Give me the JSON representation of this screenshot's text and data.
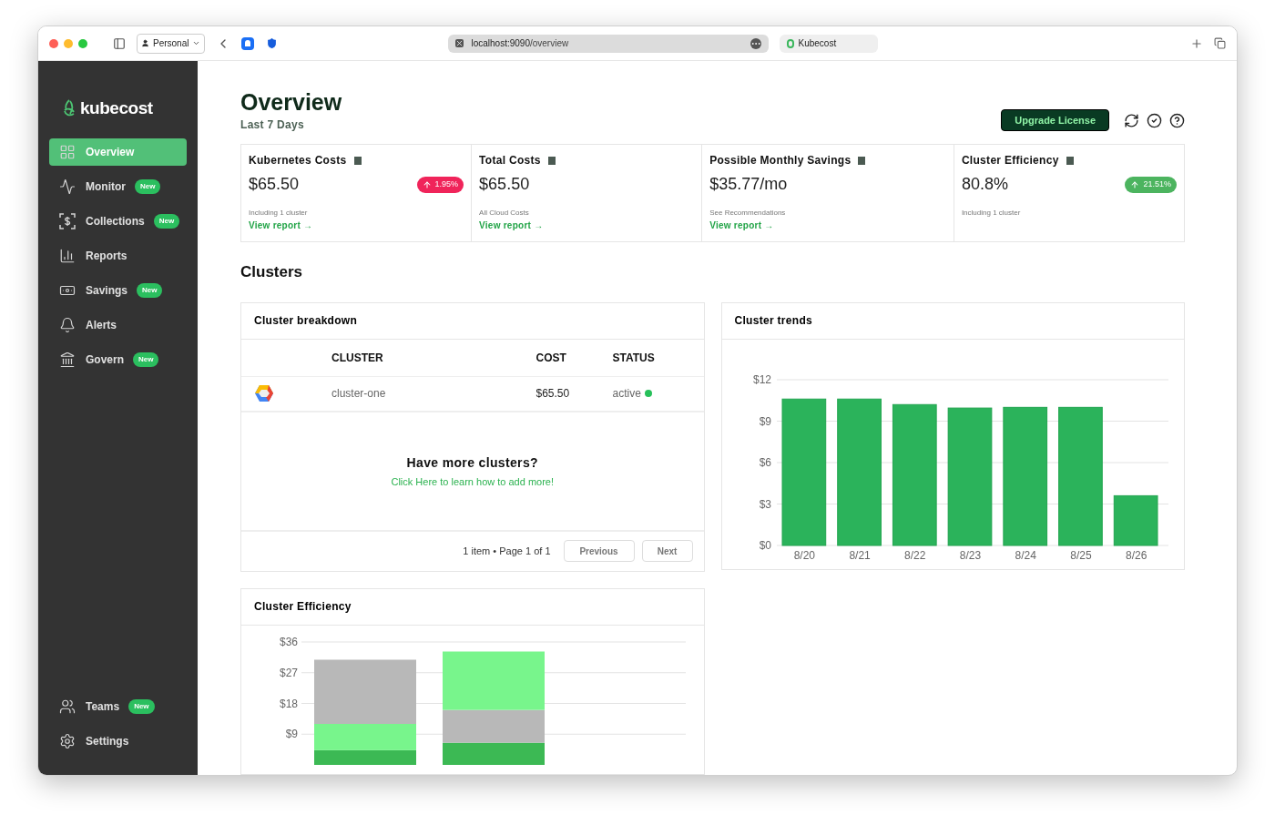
{
  "browser": {
    "profile": "Personal",
    "url_host": "localhost:9090",
    "url_path": "/overview",
    "tab_title": "Kubecost"
  },
  "sidebar": {
    "logo": "kubecost",
    "items": [
      {
        "label": "Overview",
        "selected": true
      },
      {
        "label": "Monitor",
        "badge": "New",
        "selected": false
      },
      {
        "label": "Collections",
        "badge": "New",
        "selected": false
      },
      {
        "label": "Reports",
        "selected": false
      },
      {
        "label": "Savings",
        "badge": "New",
        "selected": false
      },
      {
        "label": "Alerts",
        "selected": false
      },
      {
        "label": "Govern",
        "badge": "New",
        "selected": false
      }
    ],
    "bottom_items": [
      {
        "label": "Teams",
        "badge": "New",
        "selected": false
      },
      {
        "label": "Settings",
        "selected": false
      }
    ]
  },
  "header": {
    "title": "Overview",
    "subtitle": "Last 7 Days",
    "upgrade_button": "Upgrade License"
  },
  "stats": [
    {
      "title": "Kubernetes Costs",
      "value": "$65.50",
      "change": {
        "text": "1.95%",
        "color": "#f0245a"
      },
      "note": "Including 1 cluster",
      "link": "View report →"
    },
    {
      "title": "Total Costs",
      "value": "$65.50",
      "note": "All Cloud Costs",
      "link": "View report →"
    },
    {
      "title": "Possible Monthly Savings",
      "value": "$35.77/mo",
      "note": "See Recommendations",
      "link": "View report →"
    },
    {
      "title": "Cluster Efficiency",
      "value": "80.8%",
      "change": {
        "text": "21.51%",
        "color": "#4cb45f"
      },
      "note": "Including 1 cluster"
    }
  ],
  "clusters_title": "Clusters",
  "breakdown": {
    "title": "Cluster breakdown",
    "columns": [
      "CLUSTER",
      "COST",
      "STATUS"
    ],
    "rows": [
      {
        "name": "cluster-one",
        "cost": "$65.50",
        "status": "active"
      }
    ],
    "empty": {
      "title": "Have more clusters?",
      "link": "Click Here to learn how to add more!"
    },
    "pagination": {
      "summary": "1 item • Page 1 of 1",
      "previous": "Previous",
      "next": "Next"
    }
  },
  "trends": {
    "title": "Cluster trends",
    "chart_data": {
      "type": "bar",
      "grid": true,
      "categories": [
        "8/20",
        "8/21",
        "8/22",
        "8/23",
        "8/24",
        "8/25",
        "8/26"
      ],
      "values": [
        10.6,
        10.6,
        10.2,
        9.95,
        10.0,
        10.0,
        3.6
      ],
      "ylim": [
        0,
        12
      ],
      "yticks": [
        {
          "value": 0,
          "label": "$0"
        },
        {
          "value": 3,
          "label": "$3"
        },
        {
          "value": 6,
          "label": "$6"
        },
        {
          "value": 9,
          "label": "$9"
        },
        {
          "value": 12,
          "label": "$12"
        }
      ]
    }
  },
  "efficiency": {
    "title": "Cluster Efficiency",
    "chart_data": {
      "type": "bar",
      "stacked": true,
      "grid": true,
      "series": [
        {
          "color": "#3cb954",
          "values": [
            4.3,
            6.5
          ]
        },
        {
          "color": "#78f58c",
          "values": [
            7.7,
            0
          ]
        },
        {
          "color": "#b8b8b8",
          "values": [
            18.8,
            9.6
          ]
        },
        {
          "color": "#78f58c",
          "values": [
            0,
            17.1
          ]
        }
      ],
      "ylim": [
        0,
        36
      ],
      "yticks": [
        {
          "value": 9,
          "label": "$9"
        },
        {
          "value": 18,
          "label": "$18"
        },
        {
          "value": 27,
          "label": "$27"
        },
        {
          "value": 36,
          "label": "$36"
        }
      ]
    }
  }
}
